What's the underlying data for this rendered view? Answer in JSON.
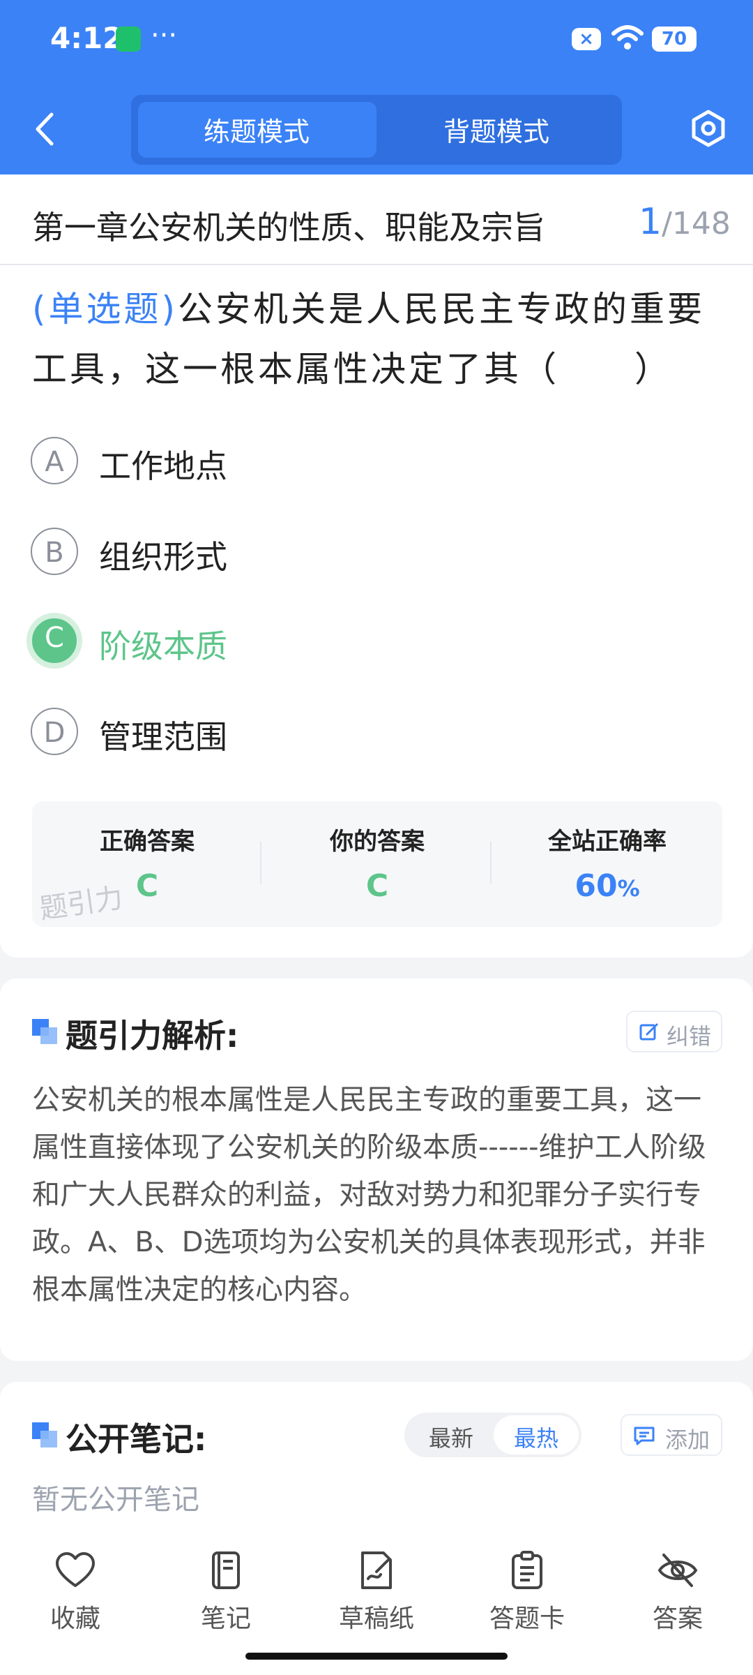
{
  "status_bar": {
    "time": "4:12",
    "dots": "···",
    "battery": "70"
  },
  "header": {
    "mode_tabs": [
      {
        "label": "练题模式",
        "active": true
      },
      {
        "label": "背题模式",
        "active": false
      }
    ]
  },
  "question": {
    "chapter": "第一章公安机关的性质、职能及宗旨",
    "index": "1",
    "total": "/148",
    "type_tag": "(单选题)",
    "text": "公安机关是人民民主专政的重要工具，这一根本属性决定了其（　　）",
    "options": [
      {
        "letter": "A",
        "text": "工作地点"
      },
      {
        "letter": "B",
        "text": "组织形式"
      },
      {
        "letter": "C",
        "text": "阶级本质"
      },
      {
        "letter": "D",
        "text": "管理范围"
      }
    ],
    "correct_letter": "C"
  },
  "answer_summary": {
    "correct_label": "正确答案",
    "correct_value": "C",
    "your_label": "你的答案",
    "your_value": "C",
    "rate_label": "全站正确率",
    "rate_value": "60",
    "rate_unit": "%",
    "watermark": "题引力"
  },
  "analysis": {
    "title": "题引力解析:",
    "report_btn": "纠错",
    "text": "公安机关的根本属性是人民民主专政的重要工具，这一属性直接体现了公安机关的阶级本质------维护工人阶级和广大人民群众的利益，对敌对势力和犯罪分子实行专政。A、B、D选项均为公安机关的具体表现形式，并非根本属性决定的核心内容。"
  },
  "notes": {
    "title": "公开笔记:",
    "sort_options": [
      {
        "label": "最新",
        "active": false
      },
      {
        "label": "最热",
        "active": true
      }
    ],
    "add_btn": "添加",
    "empty_text": "暂无公开笔记"
  },
  "bottom_tabs": [
    {
      "label": "收藏",
      "icon": "heart-icon"
    },
    {
      "label": "笔记",
      "icon": "notebook-icon"
    },
    {
      "label": "草稿纸",
      "icon": "draft-icon"
    },
    {
      "label": "答题卡",
      "icon": "clipboard-icon"
    },
    {
      "label": "答案",
      "icon": "eye-off-icon"
    }
  ],
  "colors": {
    "primary": "#3b82f6",
    "correct": "#5dc58a",
    "text": "#222222",
    "muted": "#9ca3af"
  }
}
